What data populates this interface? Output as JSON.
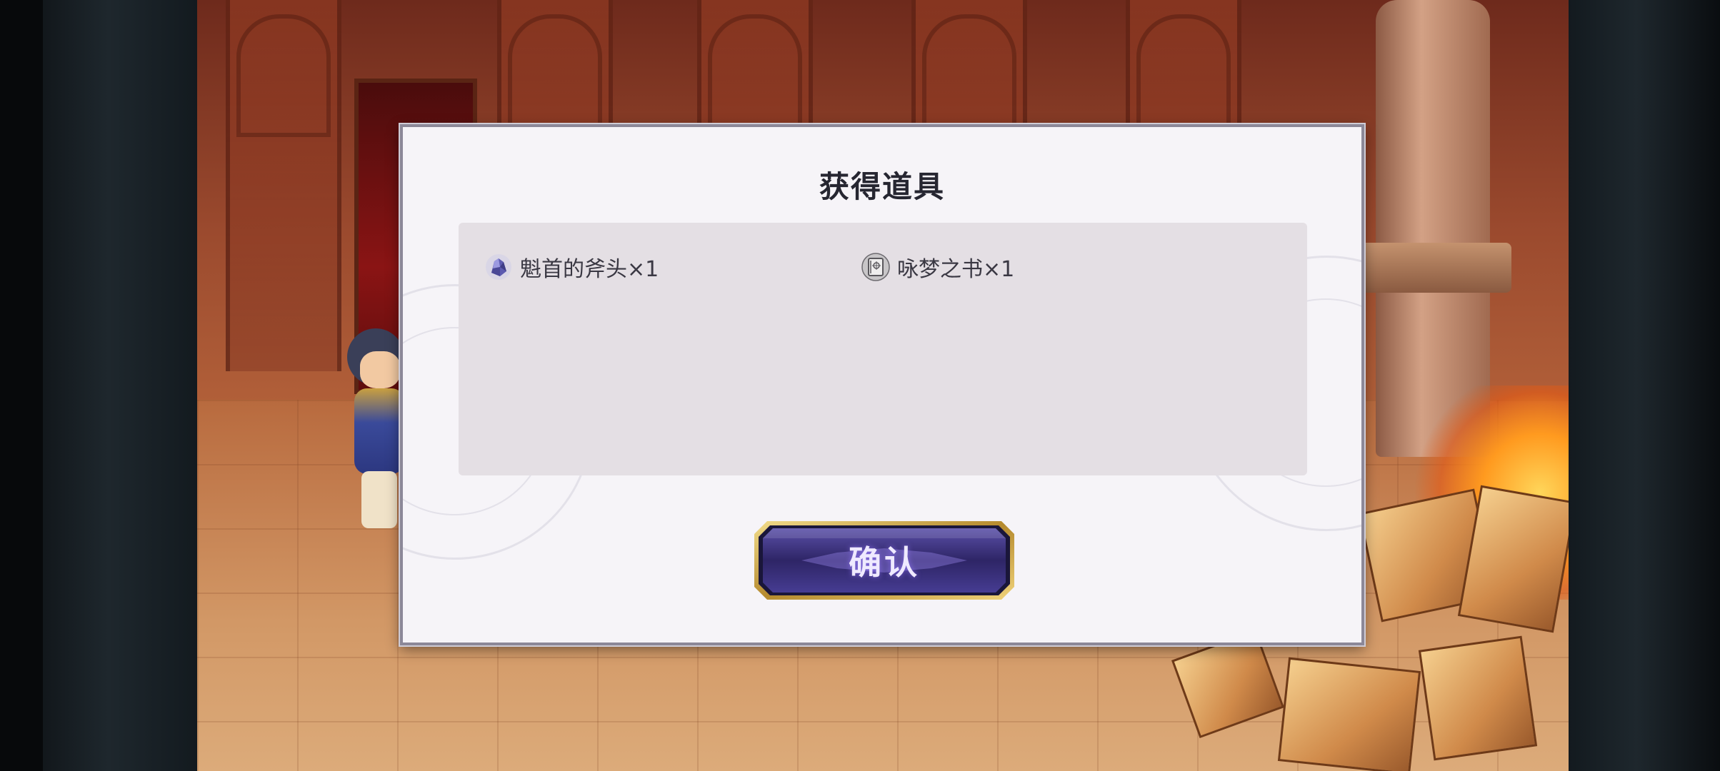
{
  "dialog": {
    "title": "获得道具",
    "rewards": [
      {
        "icon": "crystal-ore-icon",
        "label": "魁首的斧头×1"
      },
      {
        "icon": "book-icon",
        "label": "咏梦之书×1"
      }
    ],
    "confirm_label": "确认"
  },
  "colors": {
    "dialog_background": "#f6f4f8",
    "reward_panel": "#e4dfe4",
    "button_frame": "#c9a44a",
    "button_fill": "#3b2f7a"
  }
}
